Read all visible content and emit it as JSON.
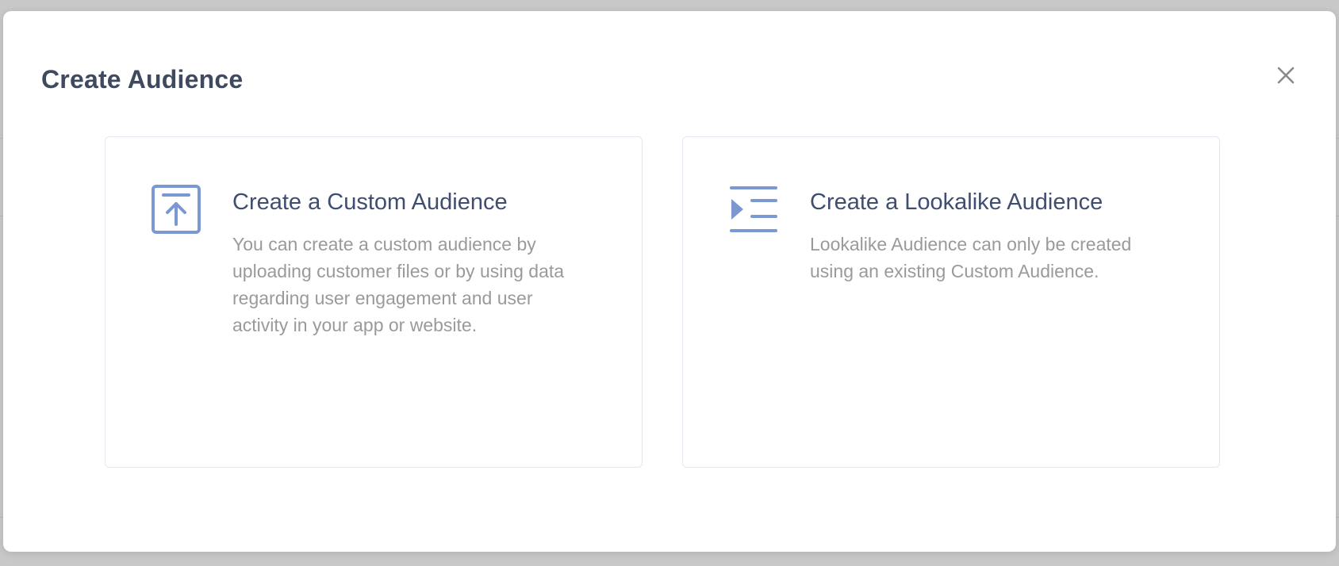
{
  "modal": {
    "title": "Create Audience",
    "close_icon": "close-icon"
  },
  "options": [
    {
      "icon": "upload-icon",
      "title": "Create a Custom Audience",
      "description": "You can create a custom audience by uploading customer files or by using data regarding user engagement and user activity in your app or website."
    },
    {
      "icon": "indent-list-icon",
      "title": "Create a Lookalike Audience",
      "description": "Lookalike Audience can only be created using an existing Custom Audience."
    }
  ],
  "colors": {
    "icon_accent": "#7b98d2",
    "title_text": "#3f4a5e",
    "card_title_text": "#3f4d70",
    "description_text": "#9a9a9a",
    "card_border": "#e3e7f0",
    "backdrop": "#c8c8c8"
  }
}
